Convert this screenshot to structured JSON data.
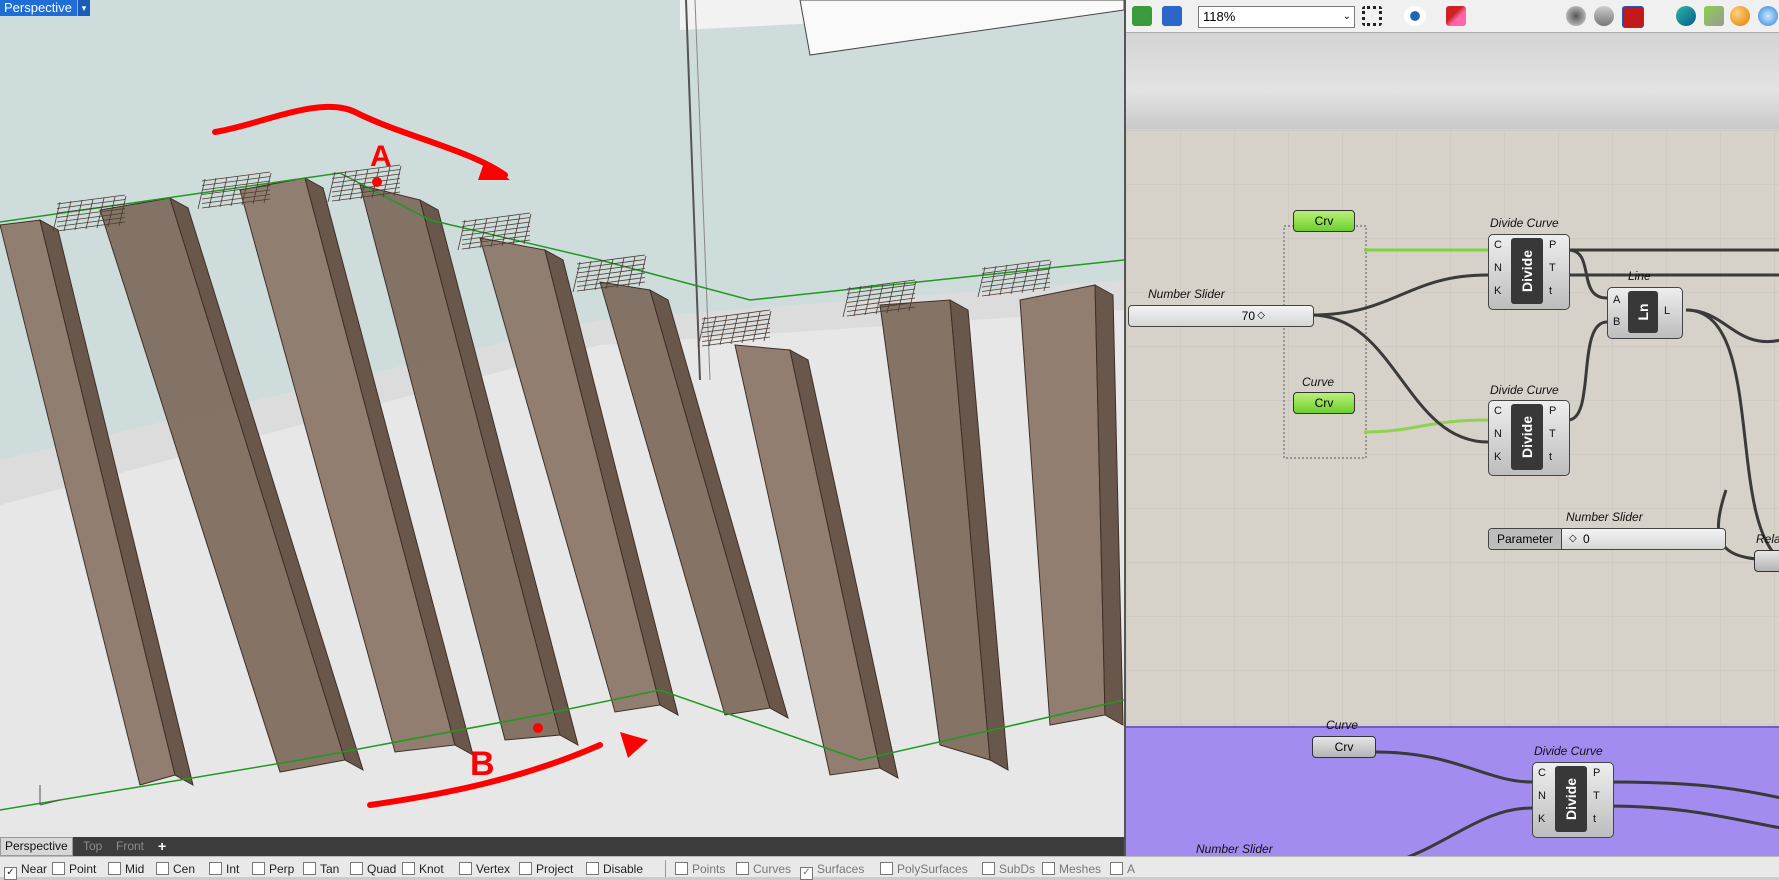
{
  "viewport": {
    "label": "Perspective",
    "dropdown_glyph": "▾",
    "annotation_a": "A",
    "annotation_b": "B",
    "tabs": [
      "Perspective",
      "Top",
      "Front"
    ],
    "add_tab_glyph": "+"
  },
  "osnaps": {
    "items": [
      {
        "label": "Near",
        "checked": true
      },
      {
        "label": "Point",
        "checked": false
      },
      {
        "label": "Mid",
        "checked": false
      },
      {
        "label": "Cen",
        "checked": false
      },
      {
        "label": "Int",
        "checked": false
      },
      {
        "label": "Perp",
        "checked": false
      },
      {
        "label": "Tan",
        "checked": false
      },
      {
        "label": "Quad",
        "checked": false
      },
      {
        "label": "Knot",
        "checked": false
      },
      {
        "label": "Vertex",
        "checked": false
      },
      {
        "label": "Project",
        "checked": false
      },
      {
        "label": "Disable",
        "checked": false
      }
    ],
    "filters": [
      {
        "label": "Points",
        "checked": false
      },
      {
        "label": "Curves",
        "checked": false
      },
      {
        "label": "Surfaces",
        "checked": true
      },
      {
        "label": "PolySurfaces",
        "checked": false
      },
      {
        "label": "SubDs",
        "checked": false
      },
      {
        "label": "Meshes",
        "checked": false
      },
      {
        "label": "A",
        "checked": false
      }
    ]
  },
  "grasshopper": {
    "zoom": "118%",
    "zoom_arrow": "⌄",
    "icons": [
      "open-file-icon",
      "save-icon",
      "zoom-extents-icon",
      "preview-eye-icon",
      "sketch-icon",
      "wire-display-icon",
      "selected-preview-icon",
      "gradient-icon",
      "shaded-preview-icon",
      "preview-mode-icon",
      "custom-preview-icon",
      "material-icon"
    ],
    "canvas": {
      "components": {
        "crv_param_top": {
          "label": "Crv"
        },
        "curve_title": "Curve",
        "crv_param_mid": {
          "label": "Crv"
        },
        "slider_top": {
          "title": "Number Slider",
          "value": "70"
        },
        "divide1": {
          "title": "Divide Curve",
          "body": "Divide",
          "inputs": [
            "C",
            "N",
            "K"
          ],
          "outputs": [
            "P",
            "T",
            "t"
          ]
        },
        "divide2": {
          "title": "Divide Curve",
          "body": "Divide",
          "inputs": [
            "C",
            "N",
            "K"
          ],
          "outputs": [
            "P",
            "T",
            "t"
          ]
        },
        "line": {
          "title": "Line",
          "body": "Ln",
          "inputs": [
            "A",
            "B"
          ],
          "outputs": [
            "L"
          ]
        },
        "param_slider": {
          "title": "Number Slider",
          "label": "Parameter",
          "value": "0"
        },
        "rel_partial": "Rela"
      }
    },
    "group": {
      "curve_title": "Curve",
      "crv_label": "Crv",
      "divide": {
        "title": "Divide Curve",
        "body": "Divide",
        "inputs": [
          "C",
          "N",
          "K"
        ],
        "outputs": [
          "P",
          "T",
          "t"
        ]
      },
      "slider_title": "Number Slider"
    }
  },
  "colors": {
    "viewport_sky": "#cfdcdc",
    "beam_fill": "#8b7566",
    "annotation_red": "#ff0000",
    "guide_green": "#1f9a1f",
    "gh_canvas": "#d6d2ca",
    "gh_group": "#a38cf0",
    "param_green": "#7ed43a"
  }
}
